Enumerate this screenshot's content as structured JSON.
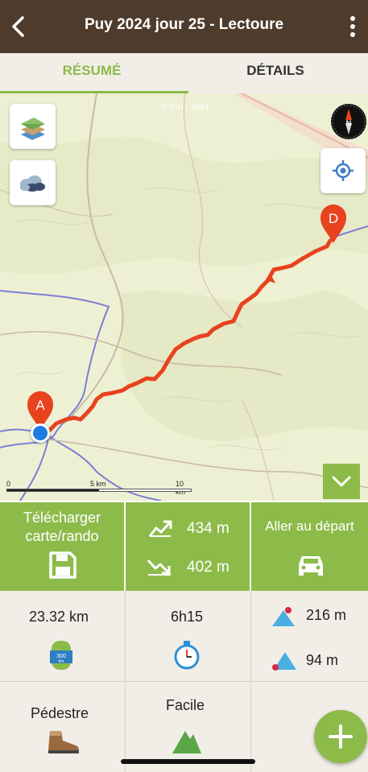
{
  "header": {
    "title": "Puy 2024 jour 25 - Lectoure",
    "back_icon": "chevron-left-icon",
    "menu_icon": "more-vertical-icon"
  },
  "tabs": [
    {
      "label": "RÉSUMÉ",
      "active": true
    },
    {
      "label": "DÉTAILS",
      "active": false
    }
  ],
  "map": {
    "attribution": "© IGN - 2024",
    "start_marker": "A",
    "end_marker": "D",
    "scale": {
      "start": "0",
      "mid": "5 km",
      "end": "10 km"
    },
    "route_color": "#e8421f",
    "accent_color": "#8dbb4a"
  },
  "actions": {
    "download_label_line1": "Télécharger",
    "download_label_line2": "carte/rando",
    "ascent": "434 m",
    "descent": "402 m",
    "goto_start_label": "Aller au départ"
  },
  "stats": {
    "distance": "23.32 km",
    "duration": "6h15",
    "max_altitude": "216 m",
    "min_altitude": "94 m",
    "activity": "Pédestre",
    "difficulty": "Facile"
  }
}
